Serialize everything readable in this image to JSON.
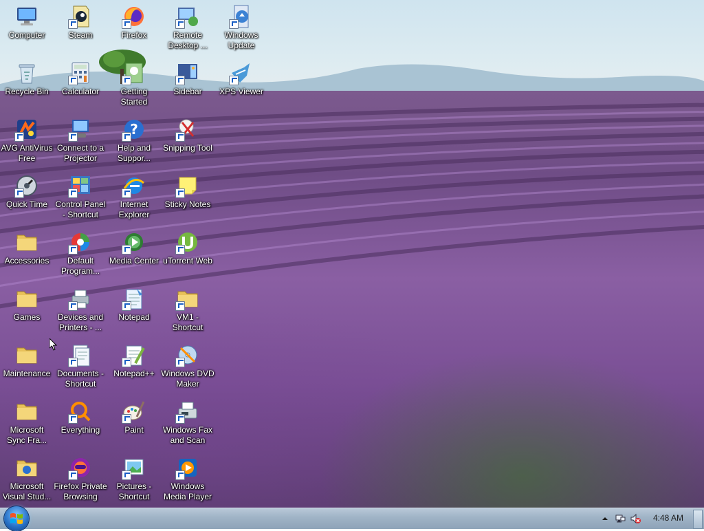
{
  "desktop": {
    "icons": [
      {
        "label": "Computer",
        "icon": "computer-icon",
        "shortcut": false
      },
      {
        "label": "Steam",
        "icon": "steam-icon",
        "shortcut": true
      },
      {
        "label": "Firefox",
        "icon": "firefox-icon",
        "shortcut": true
      },
      {
        "label": "Remote Desktop ...",
        "icon": "remote-desktop-icon",
        "shortcut": true
      },
      {
        "label": "Windows Update",
        "icon": "windows-update-icon",
        "shortcut": true
      },
      {
        "label": "Recycle Bin",
        "icon": "recycle-bin-icon",
        "shortcut": false
      },
      {
        "label": "Calculator",
        "icon": "calculator-icon",
        "shortcut": true
      },
      {
        "label": "Getting Started",
        "icon": "getting-started-icon",
        "shortcut": true
      },
      {
        "label": "Sidebar",
        "icon": "sidebar-icon",
        "shortcut": true
      },
      {
        "label": "XPS Viewer",
        "icon": "xps-viewer-icon",
        "shortcut": true
      },
      {
        "label": "AVG AntiVirus Free",
        "icon": "avg-antivirus-icon",
        "shortcut": true
      },
      {
        "label": "Connect to a Projector",
        "icon": "projector-icon",
        "shortcut": true
      },
      {
        "label": "Help and Suppor...",
        "icon": "help-icon",
        "shortcut": true
      },
      {
        "label": "Snipping Tool",
        "icon": "snipping-tool-icon",
        "shortcut": true
      },
      {
        "label": "Quick Time",
        "icon": "quicktime-icon",
        "shortcut": true
      },
      {
        "label": "Control Panel - Shortcut",
        "icon": "control-panel-icon",
        "shortcut": true
      },
      {
        "label": "Internet Explorer",
        "icon": "internet-explorer-icon",
        "shortcut": true
      },
      {
        "label": "Sticky Notes",
        "icon": "sticky-notes-icon",
        "shortcut": true
      },
      {
        "label": "Accessories",
        "icon": "folder-icon",
        "shortcut": false
      },
      {
        "label": "Default Program...",
        "icon": "default-programs-icon",
        "shortcut": true
      },
      {
        "label": "Media Center",
        "icon": "media-center-icon",
        "shortcut": true
      },
      {
        "label": "uTorrent Web",
        "icon": "utorrent-icon",
        "shortcut": true
      },
      {
        "label": "Games",
        "icon": "folder-icon",
        "shortcut": false
      },
      {
        "label": "Devices and Printers - ...",
        "icon": "devices-printers-icon",
        "shortcut": true
      },
      {
        "label": "Notepad",
        "icon": "notepad-icon",
        "shortcut": true
      },
      {
        "label": "VM1 - Shortcut",
        "icon": "folder-icon",
        "shortcut": true
      },
      {
        "label": "Maintenance",
        "icon": "folder-icon",
        "shortcut": false
      },
      {
        "label": "Documents - Shortcut",
        "icon": "documents-icon",
        "shortcut": true
      },
      {
        "label": "Notepad++",
        "icon": "notepadpp-icon",
        "shortcut": true
      },
      {
        "label": "Windows DVD Maker",
        "icon": "dvd-maker-icon",
        "shortcut": true
      },
      {
        "label": "Microsoft Sync Fra...",
        "icon": "folder-icon",
        "shortcut": false
      },
      {
        "label": "Everything",
        "icon": "everything-icon",
        "shortcut": true
      },
      {
        "label": "Paint",
        "icon": "paint-icon",
        "shortcut": true
      },
      {
        "label": "Windows Fax and Scan",
        "icon": "fax-scan-icon",
        "shortcut": true
      },
      {
        "label": "Microsoft Visual Stud...",
        "icon": "folder-help-icon",
        "shortcut": false
      },
      {
        "label": "Firefox Private Browsing",
        "icon": "firefox-private-icon",
        "shortcut": true
      },
      {
        "label": "Pictures - Shortcut",
        "icon": "pictures-icon",
        "shortcut": true
      },
      {
        "label": "Windows Media Player",
        "icon": "media-player-icon",
        "shortcut": true
      }
    ]
  },
  "taskbar": {
    "clock": "4:48 AM",
    "tray_icons": [
      "show-hidden-icons-icon",
      "network-icon",
      "volume-muted-icon"
    ]
  },
  "colors": {
    "taskbar": "#9fb3c6",
    "label_text": "#ffffff",
    "start_orb": "#2a74c9"
  }
}
